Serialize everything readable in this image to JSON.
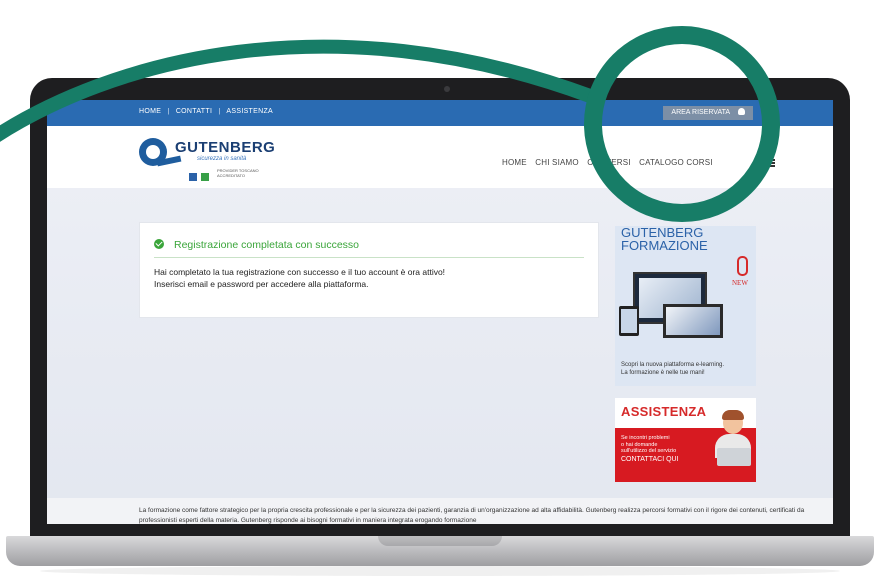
{
  "topbar": {
    "links": [
      "HOME",
      "CONTATTI",
      "ASSISTENZA"
    ],
    "separator": "|",
    "area_button": "AREA RISERVATA"
  },
  "header": {
    "logo_name": "GUTENBERG",
    "logo_tagline": "sicurezza in sanità",
    "logo_small_text": "PROVIDER TOSCANO ACCREDITATO",
    "nav": [
      "HOME",
      "CHI SIAMO",
      "CONVERSI",
      "CATALOGO CORSI"
    ]
  },
  "main": {
    "success_title": "Registrazione completata con successo",
    "message_line1": "Hai completato la tua registrazione con successo e il tuo account è ora attivo!",
    "message_line2": "Inserisci email e password per accedere alla piattaforma."
  },
  "sidebar": {
    "promo_title_line1": "GUTENBERG",
    "promo_title_line2": "FORMAZIONE",
    "promo_badge": "NEW",
    "promo_text_line1": "Scopri la nuova piattaforma e-learning.",
    "promo_text_line2": "La formazione è nelle tue mani!",
    "assist_title": "ASSISTENZA",
    "assist_text_line1": "Se incontri problemi",
    "assist_text_line2": "o hai domande",
    "assist_text_line3": "sull'utilizzo del servizio",
    "assist_cta": "CONTATTACI QUI"
  },
  "footer": {
    "text": "La formazione come fattore strategico per la propria crescita professionale e per la sicurezza dei pazienti, garanzia di un'organizzazione ad alta affidabilità. Gutenberg realizza percorsi formativi con il rigore dei contenuti, certificati da professionisti esperti della materia. Gutenberg risponde ai bisogni formativi in maniera integrata erogando formazione"
  },
  "colors": {
    "topbar": "#2a6bb2",
    "success": "#3aa53a",
    "assist_red": "#d71a21",
    "annotation_green": "#177d67"
  }
}
